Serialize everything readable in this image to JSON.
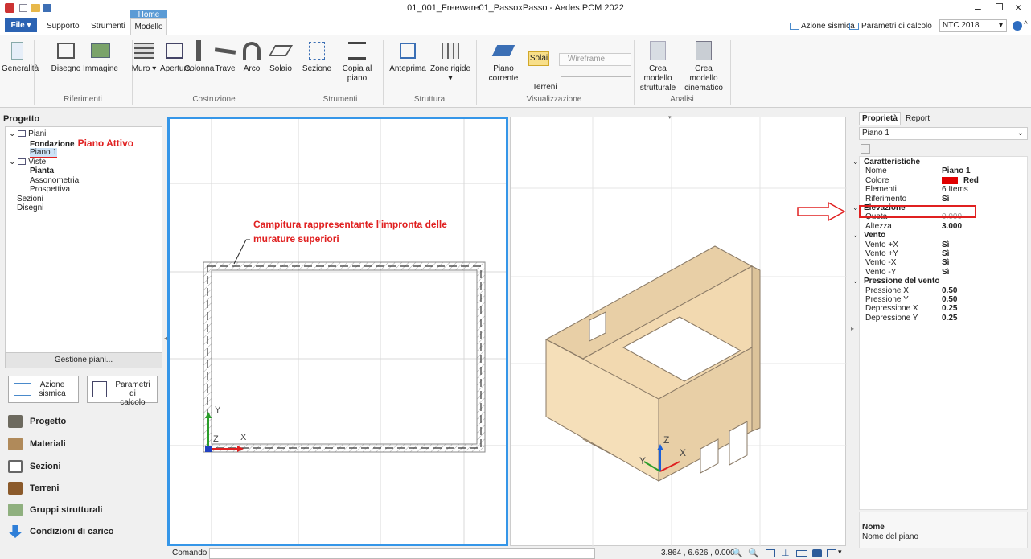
{
  "window": {
    "title": "01_001_Freeware01_PassoxPasso - Aedes.PCM 2022"
  },
  "tabs": {
    "file": "File ▾",
    "support": "Supporto",
    "tools": "Strumenti",
    "home": "Home",
    "model": "Modello"
  },
  "topright": {
    "seismic": "Azione sismica",
    "params": "Parametri di calcolo",
    "norm": "NTC 2018"
  },
  "ribbon": {
    "general": "Generalità",
    "drawing": "Disegno",
    "image": "Immagine",
    "wall": "Muro ▾",
    "opening": "Apertura",
    "column": "Colonna",
    "beam": "Trave",
    "arch": "Arco",
    "slab": "Solaio",
    "section": "Sezione",
    "copy_floor": "Copia al piano",
    "preview": "Anteprima",
    "rigid_zones": "Zone rigide ▾",
    "current_floor": "Piano corrente",
    "solai": "Solai",
    "terreni": "Terreni",
    "wireframe": "Wireframe",
    "create_struct_1": "Crea modello",
    "create_struct_2": "strutturale",
    "create_kin_1": "Crea modello",
    "create_kin_2": "cinematico",
    "groups": {
      "riferimenti": "Riferimenti",
      "costruzione": "Costruzione",
      "strumenti": "Strumenti",
      "struttura": "Struttura",
      "visualizzazione": "Visualizzazione",
      "analisi": "Analisi"
    }
  },
  "left": {
    "title": "Progetto",
    "tree": {
      "piani": "Piani",
      "fondazione": "Fondazione",
      "piano1": "Piano 1",
      "viste": "Viste",
      "pianta": "Pianta",
      "assonometria": "Assonometria",
      "prospettiva": "Prospettiva",
      "sezioni": "Sezioni",
      "disegni": "Disegni"
    },
    "active_note": "Piano Attivo",
    "manage_floors": "Gestione piani...",
    "seismic_1": "Azione",
    "seismic_2": "sismica",
    "calc_1": "Parametri di",
    "calc_2": "calcolo",
    "nav": [
      "Progetto",
      "Materiali",
      "Sezioni",
      "Terreni",
      "Gruppi strutturali",
      "Condizioni di carico"
    ]
  },
  "viewport": {
    "annotation_1": "Campitura rappresentante l'impronta delle",
    "annotation_2": "murature superiori",
    "axis_x": "X",
    "axis_y": "Y",
    "axis_z": "Z"
  },
  "props": {
    "tab_props": "Proprietà",
    "tab_report": "Report",
    "selected": "Piano 1",
    "rows": [
      {
        "cat": true,
        "k": "Caratteristiche"
      },
      {
        "k": "Nome",
        "v": "Piano 1"
      },
      {
        "k": "Colore",
        "v": "Red"
      },
      {
        "k": "Elementi",
        "v": "6 Items"
      },
      {
        "k": "Riferimento",
        "v": "Sì"
      },
      {
        "cat": true,
        "k": "Elevazione"
      },
      {
        "k": "Quota",
        "v": "0.000"
      },
      {
        "k": "Altezza",
        "v": "3.000"
      },
      {
        "cat": true,
        "k": "Vento"
      },
      {
        "k": "Vento +X",
        "v": "Sì"
      },
      {
        "k": "Vento +Y",
        "v": "Sì"
      },
      {
        "k": "Vento -X",
        "v": "Sì"
      },
      {
        "k": "Vento -Y",
        "v": "Sì"
      },
      {
        "cat": true,
        "k": "Pressione del vento"
      },
      {
        "k": "Pressione X",
        "v": "0.50"
      },
      {
        "k": "Pressione Y",
        "v": "0.50"
      },
      {
        "k": "Depressione X",
        "v": "0.25"
      },
      {
        "k": "Depressione Y",
        "v": "0.25"
      }
    ],
    "desc_title": "Nome",
    "desc_text": "Nome del piano"
  },
  "status": {
    "command_label": "Comando",
    "coords": "3.864 , 6.626 , 0.000"
  },
  "colors": {
    "accent": "#3596e8",
    "annotation": "#e02020",
    "wall": "#f2d9b0"
  }
}
